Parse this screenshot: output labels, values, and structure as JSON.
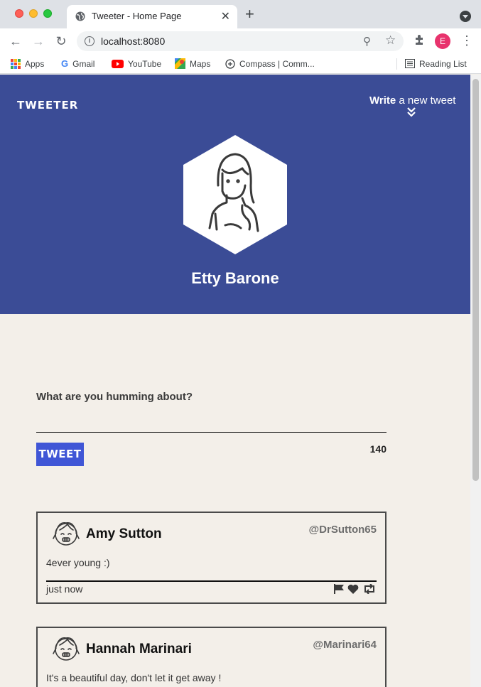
{
  "browser": {
    "tab_title": "Tweeter - Home Page",
    "url": "localhost:8080",
    "profile_initial": "E",
    "bookmarks": [
      {
        "label": "Apps"
      },
      {
        "label": "Gmail"
      },
      {
        "label": "YouTube"
      },
      {
        "label": "Maps"
      },
      {
        "label": "Compass | Comm..."
      }
    ],
    "reading_list": "Reading List"
  },
  "header": {
    "logo": "TWEETER",
    "write_bold": "Write",
    "write_rest": " a new tweet",
    "user_name": "Etty Barone"
  },
  "compose": {
    "label": "What are you humming about?",
    "button": "TWEET",
    "counter": "140"
  },
  "tweets": [
    {
      "name": "Amy Sutton",
      "handle": "@DrSutton65",
      "text": "4ever young :)",
      "time": "just now"
    },
    {
      "name": "Hannah Marinari",
      "handle": "@Marinari64",
      "text": "It's a beautiful day, don't let it get away !",
      "time": ""
    }
  ],
  "colors": {
    "header_bg": "#3b4c96",
    "tweet_button": "#4056d6",
    "page_bg": "#f3efe9"
  }
}
